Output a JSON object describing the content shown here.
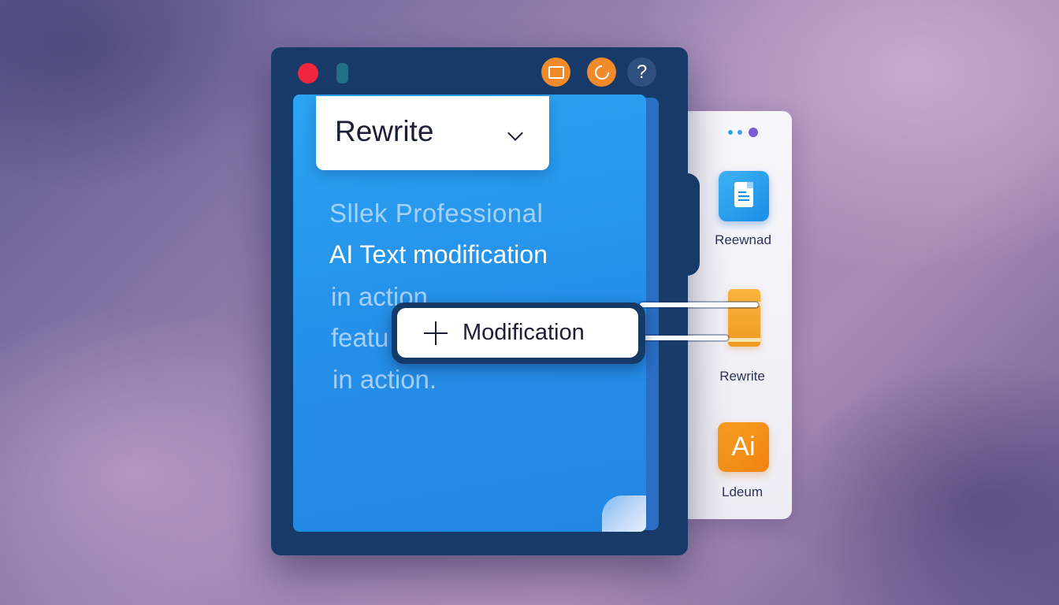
{
  "window": {
    "toolbar": {
      "close_control": "red-dot",
      "window_button_icon": "window-icon",
      "refresh_button_icon": "refresh-icon",
      "help_label": "?"
    },
    "dropdown": {
      "selected": "Rewrite"
    },
    "document": {
      "lines": [
        "Sllek Professional",
        "AI Text modification",
        "in action",
        "featu",
        "in action."
      ]
    },
    "modification_button": {
      "label": "Modification"
    }
  },
  "side_panel": {
    "items": [
      {
        "label": "Reewnad",
        "icon": "document-icon"
      },
      {
        "label": "Rewrite",
        "icon": "orange-tab-icon"
      },
      {
        "label": "Ldeum",
        "icon": "ai-icon",
        "icon_text": "Ai"
      }
    ]
  },
  "colors": {
    "window_bg": "#173a68",
    "page_blue": "#248ee8",
    "accent_orange": "#f08a2a",
    "close_red": "#f0263e",
    "panel_bg": "#f7f6fb"
  }
}
